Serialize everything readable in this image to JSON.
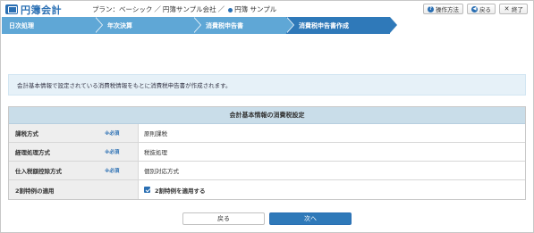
{
  "app": {
    "logo_text": "円簿会計"
  },
  "header": {
    "plan_label": "プラン：ベーシック",
    "plan_sep": "／",
    "company": "円簿サンプル会社",
    "user": "円簿 サンプル",
    "buttons": [
      {
        "label": "操作方法",
        "icon": "question-icon"
      },
      {
        "label": "戻る",
        "icon": "back-arrow-icon"
      },
      {
        "label": "終了",
        "icon": "close-icon"
      }
    ]
  },
  "steps": [
    {
      "label": "日次処理",
      "active": false
    },
    {
      "label": "年次決算",
      "active": false
    },
    {
      "label": "消費税申告書",
      "active": false
    },
    {
      "label": "消費税申告書作成",
      "active": true
    }
  ],
  "info": {
    "text": "会計基本情報で設定されている消費税情報をもとに消費税申告書が作成されます。"
  },
  "table": {
    "title": "会計基本情報の消費税設定",
    "required_text": "※必須",
    "rows": [
      {
        "label": "課税方式",
        "required": true,
        "value": "原則課税"
      },
      {
        "label": "経理処理方式",
        "required": true,
        "value": "税抜処理"
      },
      {
        "label": "仕入税額控除方式",
        "required": true,
        "value": "個別対応方式"
      },
      {
        "label": "2割特例の適用",
        "required": false,
        "value": "2割特例を適用する",
        "checked": true
      }
    ]
  },
  "footer": {
    "back_label": "戻る",
    "next_label": "次へ"
  },
  "colors": {
    "accent": "#2f79b9",
    "step": "#5fa7d6",
    "info_bg": "#e6f1f8",
    "table_head_bg": "#c9dde9"
  }
}
